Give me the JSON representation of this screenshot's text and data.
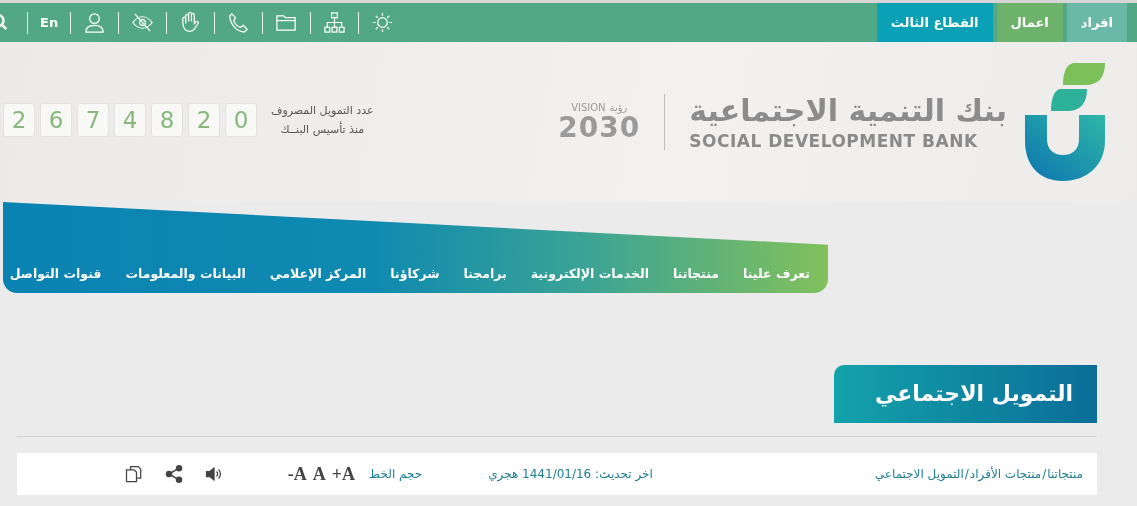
{
  "top_bar": {
    "sector_tabs": [
      {
        "label": "افراد",
        "color": "#6ab9a7"
      },
      {
        "label": "اعمال",
        "color": "#6cb26a"
      },
      {
        "label": "القطاع الثالث",
        "color": "#0aa0b5"
      }
    ],
    "language_link": "En"
  },
  "header": {
    "bank_name_arabic": "بنك التنمية الاجتماعية",
    "bank_name_english": "SOCIAL DEVELOPMENT BANK",
    "vision_logo": {
      "label": "VISION",
      "arabic": "رؤية",
      "year": "2030"
    },
    "counter": {
      "label_line_1": "عدد التمويل المصروف",
      "label_line_2": "منذ تأسيس البنــك",
      "digits": [
        "0",
        "2",
        "8",
        "4",
        "7",
        "6",
        "2"
      ]
    }
  },
  "main_nav": [
    "تعرف علينا",
    "منتجاتنا",
    "الخدمات الإلكترونية",
    "برامجنا",
    "شركاؤنا",
    "المركز الإعلامي",
    "البيانات والمعلومات",
    "قنوات التواصل"
  ],
  "page_title": "التمويل الاجتماعي",
  "toolbar": {
    "breadcrumb": [
      "منتجاتنا",
      "منتجات الأفراد",
      "التمويل الاجتماعي"
    ],
    "breadcrumb_separator": "/",
    "last_update": "اخر تحديث: 1441/01/16 هجري",
    "font_size_label": "حجم الخط",
    "font_size_buttons": [
      "+A",
      "A",
      "-A"
    ]
  }
}
